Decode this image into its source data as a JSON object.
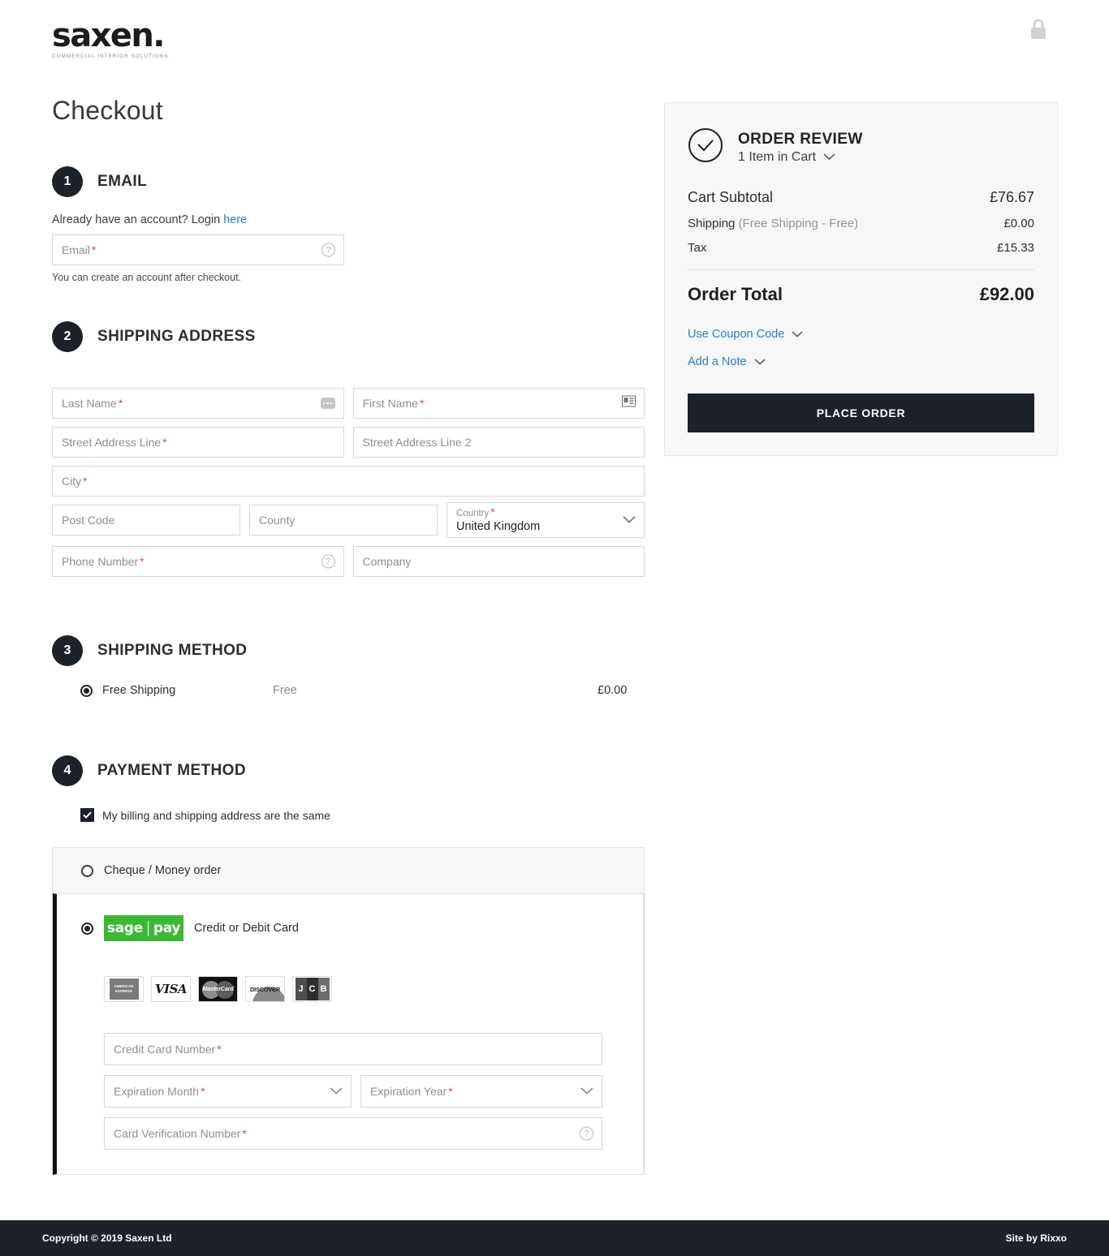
{
  "header": {
    "logo_word": "saxen.",
    "logo_tagline": "COMMERCIAL INTERIOR SOLUTIONS",
    "lock_icon": "lock-icon"
  },
  "page_title": "Checkout",
  "steps": {
    "email": {
      "number": "1",
      "title": "EMAIL",
      "login_prompt": "Already have an account? Login",
      "login_link": "here",
      "email_placeholder": "Email",
      "email_required": "*",
      "email_value": "",
      "help_icon": "question-mark-icon",
      "hint": "You can create an account after checkout."
    },
    "shipping_address": {
      "number": "2",
      "title": "SHIPPING ADDRESS",
      "fields": {
        "last_name": {
          "placeholder": "Last Name",
          "required": "*",
          "value": "",
          "icon": "autofill-dots-icon"
        },
        "first_name": {
          "placeholder": "First Name",
          "required": "*",
          "value": "",
          "icon": "contact-card-icon"
        },
        "street1": {
          "placeholder": "Street Address Line",
          "required": "*",
          "value": ""
        },
        "street2": {
          "placeholder": "Street Address Line 2",
          "required": "",
          "value": ""
        },
        "city": {
          "placeholder": "City",
          "required": "*",
          "value": ""
        },
        "post_code": {
          "placeholder": "Post Code",
          "required": "",
          "value": ""
        },
        "county": {
          "placeholder": "County",
          "required": "",
          "value": ""
        },
        "country": {
          "label": "Country",
          "required": "*",
          "value": "United Kingdom",
          "icon": "chevron-down-icon"
        },
        "phone": {
          "placeholder": "Phone Number",
          "required": "*",
          "value": "",
          "icon": "question-mark-icon"
        },
        "company": {
          "placeholder": "Company",
          "required": "",
          "value": ""
        }
      }
    },
    "shipping_method": {
      "number": "3",
      "title": "SHIPPING METHOD",
      "options": [
        {
          "name": "Free Shipping",
          "carrier": "Free",
          "price": "£0.00",
          "selected": true
        }
      ]
    },
    "payment_method": {
      "number": "4",
      "title": "PAYMENT METHOD",
      "billing_same_label": "My billing and shipping address are the same",
      "billing_same_checked": true,
      "options": [
        {
          "label": "Cheque / Money order",
          "selected": false
        },
        {
          "label": "Credit or Debit Card",
          "selected": true,
          "logo_left": "sage",
          "logo_right": "pay"
        }
      ],
      "accepted_cards": [
        "AMERICAN EXPRESS",
        "VISA",
        "MasterCard",
        "DISCOVER",
        "JCB"
      ],
      "card_fields": {
        "number": {
          "placeholder": "Credit Card Number",
          "required": "*",
          "value": ""
        },
        "exp_month": {
          "placeholder": "Expiration Month",
          "required": "*",
          "value": "",
          "icon": "chevron-down-icon"
        },
        "exp_year": {
          "placeholder": "Expiration Year",
          "required": "*",
          "value": "",
          "icon": "chevron-down-icon"
        },
        "cvn": {
          "placeholder": "Card Verification Number",
          "required": "*",
          "value": "",
          "icon": "question-mark-icon"
        }
      }
    }
  },
  "summary": {
    "title": "ORDER REVIEW",
    "items_in_cart": "1 Item in Cart",
    "check_icon": "check-circle-icon",
    "expand_icon": "chevron-down-icon",
    "lines": [
      {
        "label": "Cart Subtotal",
        "sublabel": "",
        "value": "£76.67",
        "big": true
      },
      {
        "label": "Shipping",
        "sublabel": "(Free Shipping - Free)",
        "value": "£0.00",
        "big": false
      },
      {
        "label": "Tax",
        "sublabel": "",
        "value": "£15.33",
        "big": false
      }
    ],
    "total_label": "Order Total",
    "total_value": "£92.00",
    "coupon_label": "Use Coupon Code",
    "note_label": "Add a Note",
    "place_order_label": "PLACE ORDER",
    "link_color": "#2a7fc9",
    "button_color": "#1d2228"
  },
  "footer": {
    "copyright": "Copyright © 2019 Saxen Ltd",
    "credit": "Site by Rixxo"
  }
}
